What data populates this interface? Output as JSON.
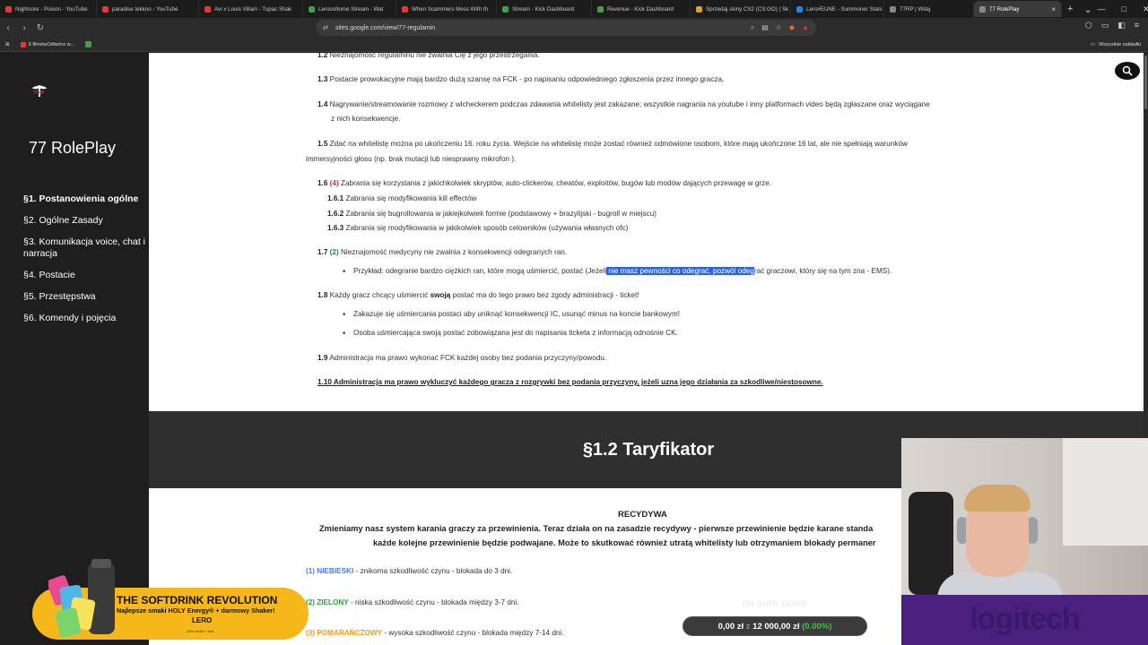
{
  "tabs": [
    {
      "label": "Nightcore - Poison - YouTube",
      "color": "#e53935"
    },
    {
      "label": "paradise tekkno - YouTube",
      "color": "#e53935"
    },
    {
      "label": "Avi x Louis Villain - Tupac Shak",
      "color": "#e53935"
    },
    {
      "label": "Leroooltome Stream - Wat",
      "color": "#43a047"
    },
    {
      "label": "When Scammers Mess With th",
      "color": "#e53935"
    },
    {
      "label": "Stream - Kick Dashboard",
      "color": "#43a047"
    },
    {
      "label": "Revenue - Kick Dashboard",
      "color": "#43a047"
    },
    {
      "label": "Sprzedaj skiny CS2 (CS:GO) | Sk",
      "color": "#e0a030"
    },
    {
      "label": "Lero#EUNE - Summoner Stats",
      "color": "#1e88e5"
    },
    {
      "label": "77RP | Witaj",
      "color": "#888888"
    },
    {
      "label": "77 RolePlay",
      "color": "#888888",
      "active": true
    }
  ],
  "toolbar": {
    "url": "sites.google.com/view/77-regulamin"
  },
  "bookmarks": {
    "item1": "6 filmówOdtwórz w...",
    "folder": "Wszystkie zakładki"
  },
  "sidebar": {
    "title": "77 RolePlay",
    "items": [
      {
        "label": "§1. Postanowienia ogólne"
      },
      {
        "label": "§2. Ogólne Zasady"
      },
      {
        "label": "§3. Komunikacja voice, chat i narracja"
      },
      {
        "label": "§4. Postacie"
      },
      {
        "label": "§5. Przestępstwa"
      },
      {
        "label": "§6. Komendy i pojęcia"
      }
    ]
  },
  "rules": {
    "r12_num": "1.2",
    "r12": "Nieznajomość regulaminu nie zwalnia Cię z jego przestrzegania.",
    "r13_num": "1.3",
    "r13": "Postacie prowokacyjne mają bardzo dużą szansę na FCK - po napisaniu odpowiedniego zgłoszenia przez innego gracza.",
    "r14_num": "1.4",
    "r14a": "Nagrywanie/streamowanie rozmowy z wlcheckerem podczas zdawania whitelisty jest zakazane; wszystkie nagrania na youtube i inny platformach video będą zgłaszane oraz wyciągane",
    "r14b": "z nich konsekwencje.",
    "r15_num": "1.5",
    "r15a": "Zdać na whitelistę można po ukończeniu 16. roku życia. Wejście na whitelistę może zostać również odmówione osobom, które mają ukończone 16 lat, ale nie spełniają warunków",
    "r15b": "immersyjności głosu (np. brak mutacji lub niesprawny mikrofon ).",
    "r16_num": "1.6",
    "r16_tag": "(4)",
    "r16": "Zabrania się korzystania z jakichkolwiek skryptów, auto-clickerów, cheatów, exploitów, bugów lub modów dających przewagę w grze.",
    "r161_num": "1.6.1",
    "r161": "Zabrania się modyfikowania kill effectów",
    "r162_num": "1.6.2",
    "r162": "Zabrania się bugrollowania w jakiejkolwiek formie (podstawowy + brazylijski - bugroll w miejscu)",
    "r163_num": "1.6.3",
    "r163": "Zabrania się modyfikowania w jakikolwiek sposób celowników (używania własnych ofc)",
    "r17_num": "1.7",
    "r17_tag": "(2)",
    "r17": "Nieznajomość medycyny nie zwalnia z konsekwencji odegranych ran.",
    "r17b_pre": "Przykład: odegranie bardzo ciężkich ran, które mogą uśmiercić, postać (Jeżeli",
    "r17b_hl": " nie masz pewności co odegrać, pozwól odeg",
    "r17b_post": "rać graczowi, który się na tym zna - EMS).",
    "r18_num": "1.8",
    "r18_pre": "Każdy gracz chcący uśmiercić",
    "r18_bold": "swoją",
    "r18_post": "postać ma do tego prawo bez zgody administracji - ticket!",
    "r18a": "Zakazuje się uśmiercania postaci aby uniknąć konsekwencji IC, usunąć minus na koncie bankowym!",
    "r18b": "Osoba uśmiercająca swoją postać zobowiązana jest do napisania ticketa z informacją odnośnie CK.",
    "r19_num": "1.9",
    "r19": "Administracja ma prawo wykonać FCK każdej osoby bez podania przyczyny/powodu.",
    "r110": "1.10 Administracja ma prawo wykluczyć każdego gracza z rozgrywki bez podania przyczyny, jeżeli uzna jego działania za szkodliwe/niestosowne."
  },
  "section2": {
    "title": "§1.2 Taryfikator",
    "heading": "RECYDYWA",
    "para1": "Zmieniamy nasz system karania graczy za przewinienia. Teraz działa on na zasadzie recydywy - pierwsze przewinienie będzie karane standa",
    "para2": "każde kolejne przewinienie będzie podwajane. Może to skutkować również utratą whitelisty lub otrzymaniem blokady permaner",
    "t1_tag": "(1) NIEBIESKI",
    "t1": "- znikoma szkodliwość czynu - blokada do 3 dni.",
    "t2_tag": "(2) ZIELONY",
    "t2": "- niska szkodliwość czynu -  blokada między 3-7 dni.",
    "t3_tag": "(3) POMARAŃCZOWY",
    "t3": "- wysoka szkodliwość czynu - blokada między 7-14 dni."
  },
  "goal": {
    "label": "na auto nowe",
    "current": "0,00 zł",
    "sep": "z",
    "target": "12 000,00 zł",
    "percent": "(0.00%)",
    "progress_fraction": 0.0
  },
  "promo": {
    "title": "THE SOFTDRINK REVOLUTION",
    "sub": "Najlepsze smaki HOLY Energy® + darmowy Shaker!",
    "code": "LERO",
    "tiny": "10% zniżki + kod"
  },
  "logitech": "logitech",
  "colors": {
    "blue": "#4a7be8",
    "green": "#2e9e37",
    "orange": "#f39c12",
    "highlight": "#2f64d9"
  }
}
